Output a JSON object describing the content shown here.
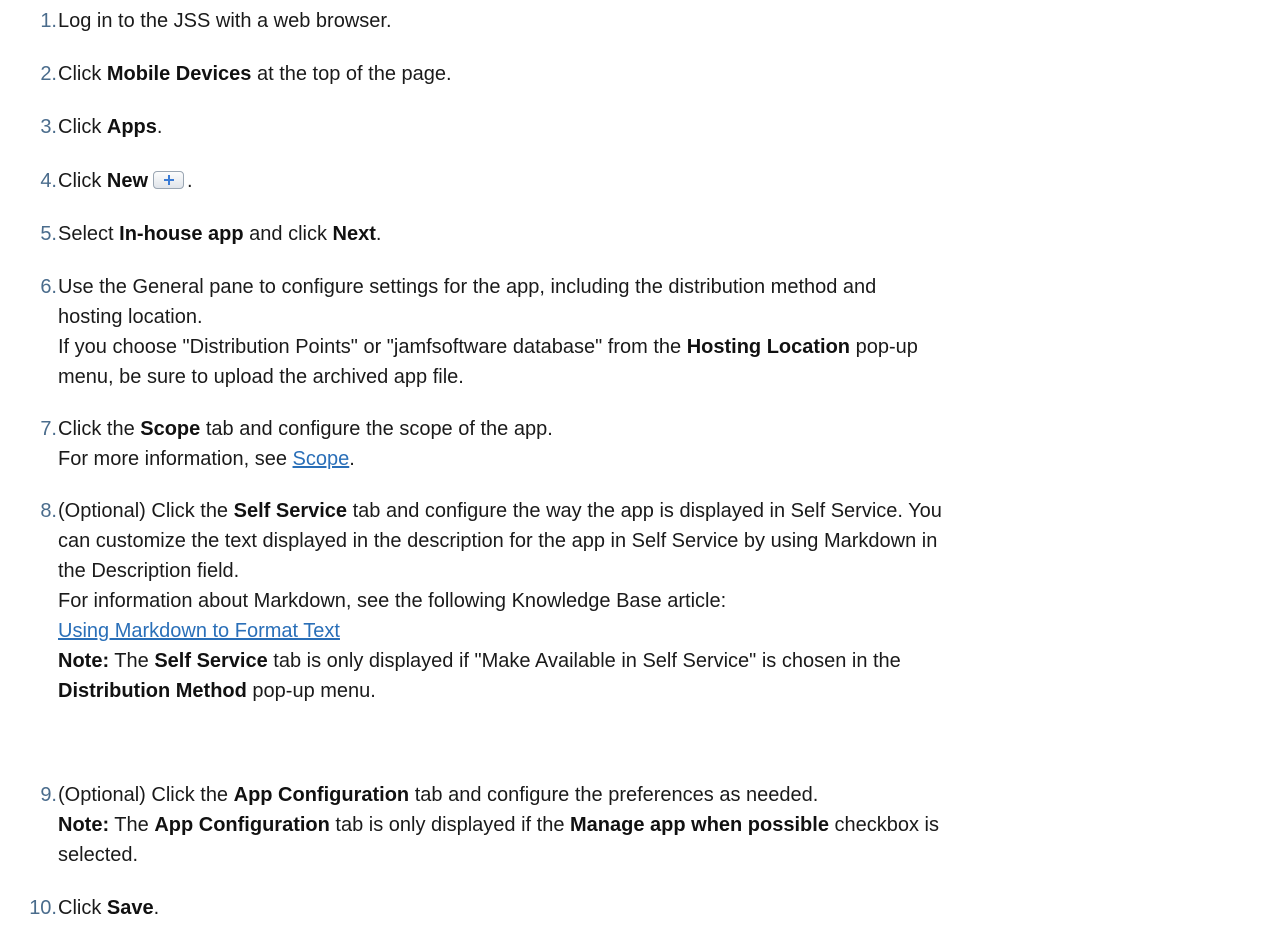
{
  "steps": [
    {
      "number": "1.",
      "text": "Log in to the JSS with a web browser."
    },
    {
      "number": "2.",
      "pre": "Click ",
      "bold": "Mobile Devices",
      "post": " at the top of the page."
    },
    {
      "number": "3.",
      "pre": "Click ",
      "bold": "Apps",
      "post": "."
    },
    {
      "number": "4.",
      "pre": "Click ",
      "bold": "New",
      "post": ".",
      "icon": "plus-icon"
    },
    {
      "number": "5.",
      "pre": "Select ",
      "bold1": "In-house app",
      "mid": " and click ",
      "bold2": "Next",
      "post": "."
    },
    {
      "number": "6.",
      "line1": "Use the General pane to configure settings for the app, including the distribution method and",
      "line2": "hosting location.",
      "line3_pre": "If you choose \"Distribution Points\" or \"jamfsoftware database\" from the ",
      "line3_bold": "Hosting Location",
      "line3_post": " pop-up",
      "line4": "menu, be sure to upload the archived app file."
    },
    {
      "number": "7.",
      "line1_pre": "Click the ",
      "line1_bold": "Scope",
      "line1_post": " tab and configure the scope of the app.",
      "line2_pre": "For more information, see ",
      "line2_link": "Scope",
      "line2_post": "."
    },
    {
      "number": "8.",
      "line1_pre": "(Optional) Click the ",
      "line1_bold": "Self Service",
      "line1_post": " tab and configure the way the app is displayed in Self Service. You",
      "line2": "can customize the text displayed in the description for the app in Self Service by using Markdown in",
      "line3": "the Description field.",
      "line4": "For information about Markdown, see the following Knowledge Base article:",
      "line5_link": "Using Markdown to Format Text",
      "line6_note": "Note:",
      "line6_pre": " The ",
      "line6_bold": "Self Service",
      "line6_post": " tab is only displayed if \"Make Available in Self Service\" is chosen in the",
      "line7_bold": "Distribution Method",
      "line7_post": " pop-up menu."
    },
    {
      "number": "9.",
      "line1_pre": "(Optional) Click the ",
      "line1_bold": "App Configuration",
      "line1_post": " tab and configure the preferences as needed.",
      "line2_note": "Note:",
      "line2_pre": " The ",
      "line2_bold1": "App Configuration",
      "line2_mid": " tab is only displayed if the ",
      "line2_bold2": "Manage app when possible",
      "line2_post": " checkbox is",
      "line3": "selected."
    },
    {
      "number": "10.",
      "pre": "Click ",
      "bold": "Save",
      "post": "."
    }
  ],
  "colors": {
    "number": "#4a6c8c",
    "link": "#2a6fb8",
    "text": "#1a1a1a"
  }
}
